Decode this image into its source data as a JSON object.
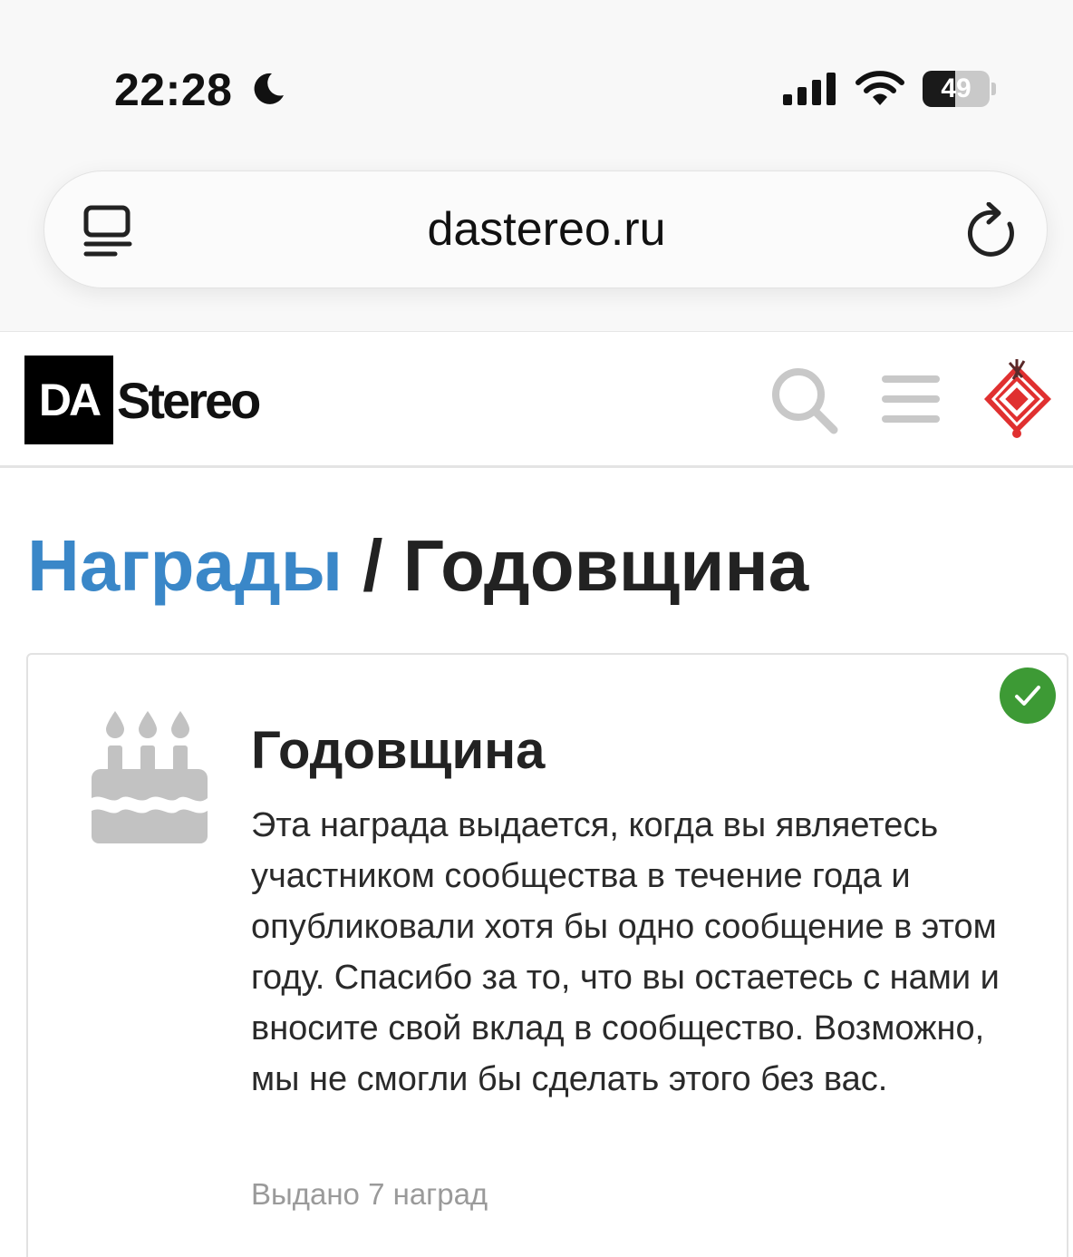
{
  "status_bar": {
    "time": "22:28",
    "battery_percent": "49",
    "battery_level": 0.49
  },
  "browser": {
    "url": "dastereo.ru"
  },
  "site": {
    "logo_box_text": "DA",
    "logo_text": "Stereo"
  },
  "page": {
    "breadcrumb_link": "Награды",
    "separator": "/",
    "title": "Годовщина"
  },
  "award": {
    "title": "Годовщина",
    "description": "Эта награда выдается, когда вы являетесь участником сообщества в течение года и опубликовали хотя бы одно сообщение в этом году. Спасибо за то, что вы остаетесь с нами и вносите свой вклад в сообщество. Возможно, мы не смогли бы сделать этого без вас.",
    "count_text": "Выдано 7 наград",
    "icon": "birthday-cake-icon",
    "earned_icon": "check-icon"
  },
  "colors": {
    "link": "#3a87c8",
    "earned": "#3d9a35",
    "icon_gray": "#c2c2c2"
  }
}
